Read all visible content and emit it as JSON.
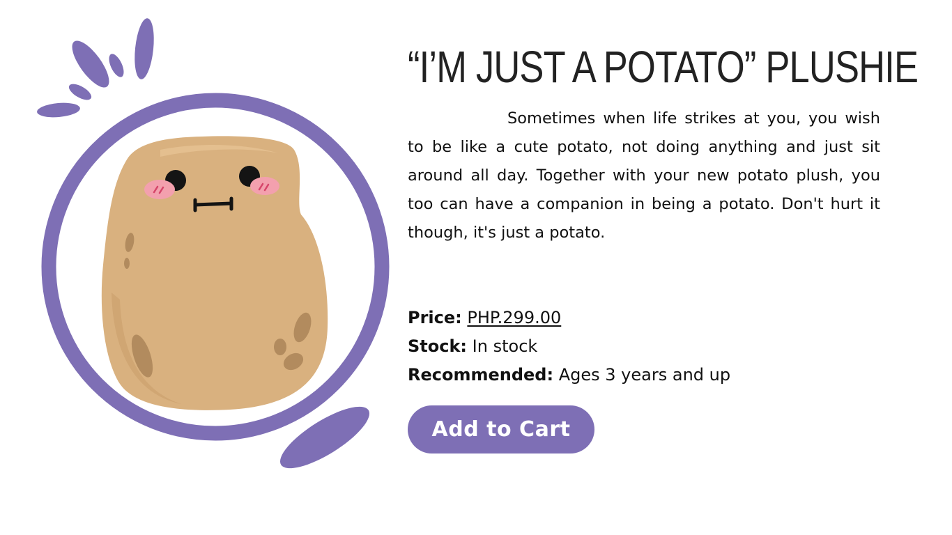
{
  "product": {
    "title": "“I’M JUST A POTATO” PLUSHIE",
    "description": "Sometimes when life strikes at you, you wish to be like a cute potato, not doing anything and just sit around all day. Together with your new potato plush, you too can have a companion in being a potato. Don't hurt it though, it's just a potato.",
    "image_alt": "potato plushie",
    "details": {
      "price_label": "Price:",
      "price_value": "PHP.299.00",
      "stock_label": "Stock:",
      "stock_value": "In stock",
      "recommended_label": "Recommended:",
      "recommended_value": "Ages 3 years and up"
    },
    "add_to_cart_label": "Add to Cart"
  },
  "colors": {
    "accent": "#7e6fb5",
    "potato": "#d9b17f",
    "blush": "#f3a0ae"
  }
}
